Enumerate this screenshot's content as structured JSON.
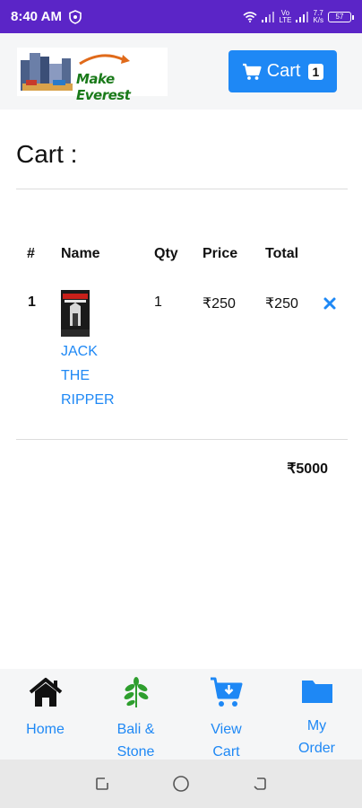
{
  "status_bar": {
    "time": "8:40 AM",
    "net_speed_top": "7.7",
    "net_speed_bottom": "K/s",
    "battery": "57",
    "volte": "Vo LTE"
  },
  "header": {
    "logo_text": "Make Everest",
    "cart_label": "Cart",
    "cart_count": "1"
  },
  "page": {
    "title": "Cart :"
  },
  "table": {
    "headers": [
      "#",
      "Name",
      "Qty",
      "Price",
      "Total"
    ],
    "rows": [
      {
        "index": "1",
        "name_lines": [
          "JACK",
          "THE",
          "RIPPER"
        ],
        "qty": "1",
        "price": "₹250",
        "total": "₹250"
      }
    ],
    "grand_total": "₹5000"
  },
  "bottom_nav": {
    "items": [
      {
        "label_1": "Home",
        "label_2": "",
        "icon": "home-icon"
      },
      {
        "label_1": "Bali &",
        "label_2": "Stone",
        "icon": "leaf-icon"
      },
      {
        "label_1": "View",
        "label_2": "Cart",
        "icon": "cart-download-icon"
      },
      {
        "label_1": "My",
        "label_2": "Order",
        "icon": "folder-icon"
      }
    ]
  },
  "colors": {
    "status_bar": "#5b25c7",
    "accent": "#1e88f5",
    "header_bg": "#f5f6f7",
    "leaf": "#2e9e2e"
  }
}
